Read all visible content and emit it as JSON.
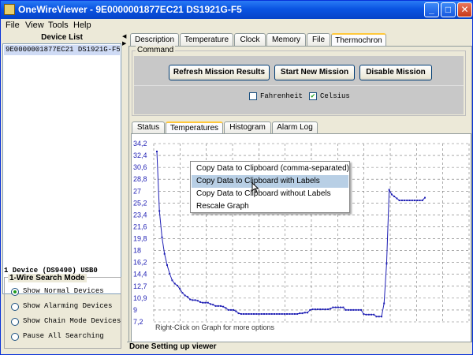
{
  "window": {
    "title": "OneWireViewer - 9E0000001877EC21 DS1921G-F5",
    "buttons": {
      "minimize": "_",
      "maximize": "□",
      "close": "✕"
    }
  },
  "menu": [
    "File",
    "View",
    "Tools",
    "Help"
  ],
  "device_list": {
    "header": "Device List",
    "items": [
      "9E0000001877EC21 DS1921G-F5"
    ]
  },
  "adapter_info": "1 Device  (DS9490) USB0",
  "search_mode": {
    "title": "1-Wire Search Mode",
    "options": [
      "Show Normal Devices",
      "Show Alarming Devices",
      "Show Chain Mode Devices",
      "Pause All Searching"
    ],
    "selected_index": 0
  },
  "main_tabs": [
    "Description",
    "Temperature",
    "Clock",
    "Memory",
    "File",
    "Thermochron"
  ],
  "main_tab_active": "Thermochron",
  "command": {
    "title": "Command",
    "buttons": [
      "Refresh Mission Results",
      "Start New Mission",
      "Disable Mission"
    ],
    "units": [
      {
        "label": "Fahrenheit",
        "checked": false
      },
      {
        "label": "Celsius",
        "checked": true
      }
    ]
  },
  "sub_tabs": [
    "Status",
    "Temperatures",
    "Histogram",
    "Alarm Log"
  ],
  "sub_tab_active": "Temperatures",
  "graph": {
    "hint": "Right-Click on Graph for more options",
    "y_ticks": [
      "34,2",
      "32,4",
      "30,6",
      "28,8",
      "27",
      "25,2",
      "23,4",
      "21,6",
      "19,8",
      "18",
      "16,2",
      "14,4",
      "12,7",
      "10,9",
      "9",
      "7,2"
    ]
  },
  "chart_data": {
    "type": "line",
    "title": "",
    "xlabel": "",
    "ylabel": "",
    "ylim": [
      7.2,
      34.2
    ],
    "grid": true,
    "series": [
      {
        "values": [
          33.0,
          24.0,
          20.0,
          17.5,
          15.8,
          14.5,
          13.5,
          13.0,
          12.7,
          12.2,
          11.6,
          11.2,
          11.0,
          10.6,
          10.5,
          10.5,
          10.4,
          10.2,
          10.1,
          10.1,
          10.1,
          9.9,
          9.8,
          9.6,
          9.6,
          9.6,
          9.5,
          9.3,
          9.0,
          9.0,
          9.0,
          8.8,
          8.5,
          8.4,
          8.4,
          8.4,
          8.4,
          8.4,
          8.4,
          8.4,
          8.4,
          8.4,
          8.4,
          8.4,
          8.4,
          8.4,
          8.4,
          8.4,
          8.4,
          8.4,
          8.4,
          8.4,
          8.4,
          8.4,
          8.4,
          8.4,
          8.5,
          8.5,
          8.6,
          8.6,
          9.0,
          9.1,
          9.1,
          9.1,
          9.1,
          9.1,
          9.1,
          9.1,
          9.2,
          9.4,
          9.4,
          9.4,
          9.4,
          9.4,
          9.0,
          9.0,
          9.0,
          9.0,
          9.0,
          9.0,
          9.0,
          8.4,
          8.3,
          8.3,
          8.3,
          8.3,
          8.0,
          8.0,
          8.0,
          10.0,
          16.0,
          27.2,
          26.5,
          26.2,
          25.9,
          25.6,
          25.6,
          25.6,
          25.6,
          25.6,
          25.6,
          25.6,
          25.6,
          25.6,
          25.6,
          26.0
        ]
      }
    ]
  },
  "context_menu": {
    "items": [
      "Copy Data to Clipboard (comma-separated)",
      "Copy Data to Clipboard with Labels",
      "Copy Data to Clipboard without Labels",
      "Rescale Graph"
    ],
    "highlighted_index": 1
  },
  "status_bar": "Done Setting up viewer",
  "colors": {
    "accent": "#0a54e2",
    "plot_line": "#1f1fb4",
    "menu_highlight": "#b8cfe5"
  }
}
